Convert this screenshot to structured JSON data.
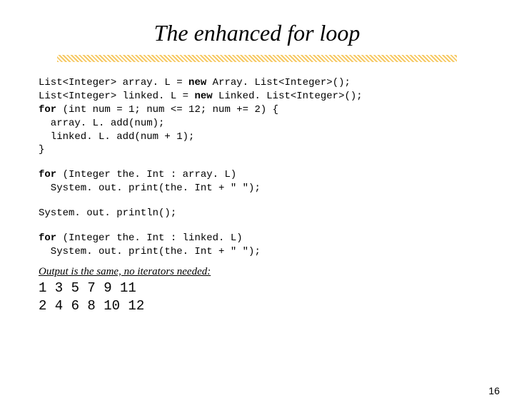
{
  "title": "The enhanced for loop",
  "code": {
    "l1a": "List<Integer> array. L = ",
    "l1b": "new",
    "l1c": " Array. List<Integer>();",
    "l2a": "List<Integer> linked. L = ",
    "l2b": "new",
    "l2c": " Linked. List<Integer>();",
    "l3a": "for",
    "l3b": " (int num = 1; num <= 12; num += 2) {",
    "l4": "  array. L. add(num);",
    "l5": "  linked. L. add(num + 1);",
    "l6": "}",
    "l7a": "for",
    "l7b": " (Integer the. Int : array. L)",
    "l8": "  System. out. print(the. Int + \" \");",
    "l9": "System. out. println();",
    "l10a": "for",
    "l10b": " (Integer the. Int : linked. L)",
    "l11": "  System. out. print(the. Int + \" \");"
  },
  "output_label": "Output is the same, no iterators needed:",
  "output_line1": "1 3 5 7 9 11",
  "output_line2": "2 4 6 8 10 12",
  "page_number": "16"
}
